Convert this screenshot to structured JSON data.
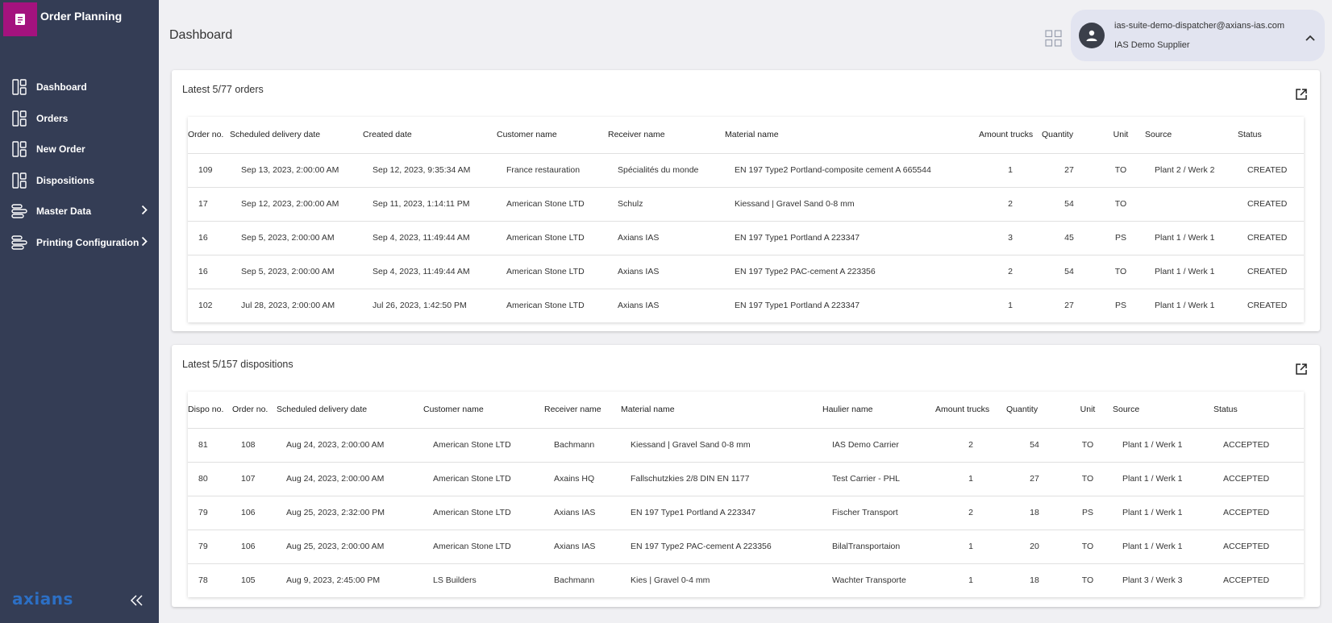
{
  "app": {
    "title": "Order Planning"
  },
  "sidebar": {
    "items": [
      {
        "label": "Dashboard",
        "icon": "dashboard-icon"
      },
      {
        "label": "Orders",
        "icon": "dashboard-icon"
      },
      {
        "label": "New Order",
        "icon": "dashboard-icon"
      },
      {
        "label": "Dispositions",
        "icon": "dashboard-icon"
      },
      {
        "label": "Master Data",
        "icon": "layers-icon"
      },
      {
        "label": "Printing Configuration",
        "icon": "layers-icon"
      }
    ],
    "logo_text": "axians"
  },
  "header": {
    "title": "Dashboard"
  },
  "user": {
    "email": "ias-suite-demo-dispatcher@axians-ias.com",
    "org": "IAS Demo Supplier"
  },
  "orders": {
    "title": "Latest 5/77 orders",
    "columns": [
      "Order no.",
      "Scheduled delivery date",
      "Created date",
      "Customer name",
      "Receiver name",
      "Material name",
      "Amount trucks",
      "Quantity",
      "Unit",
      "Source",
      "Status"
    ],
    "rows": [
      [
        "109",
        "Sep 13, 2023, 2:00:00 AM",
        "Sep 12, 2023, 9:35:34 AM",
        "France restauration",
        "Spécialités du monde",
        "EN 197 Type2 Portland-composite cement A 665544",
        "1",
        "27",
        "TO",
        "Plant 2 / Werk 2",
        "CREATED"
      ],
      [
        "17",
        "Sep 12, 2023, 2:00:00 AM",
        "Sep 11, 2023, 1:14:11 PM",
        "American Stone LTD",
        "Schulz",
        "Kiessand | Gravel Sand 0-8 mm",
        "2",
        "54",
        "TO",
        "",
        "CREATED"
      ],
      [
        "16",
        "Sep 5, 2023, 2:00:00 AM",
        "Sep 4, 2023, 11:49:44 AM",
        "American Stone LTD",
        "Axians IAS",
        "EN 197 Type1 Portland A 223347",
        "3",
        "45",
        "PS",
        "Plant 1 / Werk 1",
        "CREATED"
      ],
      [
        "16",
        "Sep 5, 2023, 2:00:00 AM",
        "Sep 4, 2023, 11:49:44 AM",
        "American Stone LTD",
        "Axians IAS",
        "EN 197 Type2 PAC-cement A 223356",
        "2",
        "54",
        "TO",
        "Plant 1 / Werk 1",
        "CREATED"
      ],
      [
        "102",
        "Jul 28, 2023, 2:00:00 AM",
        "Jul 26, 2023, 1:42:50 PM",
        "American Stone LTD",
        "Axians IAS",
        "EN 197 Type1 Portland A 223347",
        "1",
        "27",
        "PS",
        "Plant 1 / Werk 1",
        "CREATED"
      ]
    ]
  },
  "dispositions": {
    "title": "Latest 5/157 dispositions",
    "columns": [
      "Dispo no.",
      "Order no.",
      "Scheduled delivery date",
      "Customer name",
      "Receiver name",
      "Material name",
      "Haulier name",
      "Amount trucks",
      "Quantity",
      "Unit",
      "Source",
      "Status"
    ],
    "rows": [
      [
        "81",
        "108",
        "Aug 24, 2023, 2:00:00 AM",
        "American Stone LTD",
        "Bachmann",
        "Kiessand | Gravel Sand 0-8 mm",
        "IAS Demo Carrier",
        "2",
        "54",
        "TO",
        "Plant 1 / Werk 1",
        "ACCEPTED"
      ],
      [
        "80",
        "107",
        "Aug 24, 2023, 2:00:00 AM",
        "American Stone LTD",
        "Axains HQ",
        "Fallschutzkies 2/8 DIN EN 1177",
        "Test Carrier - PHL",
        "1",
        "27",
        "TO",
        "Plant 1 / Werk 1",
        "ACCEPTED"
      ],
      [
        "79",
        "106",
        "Aug 25, 2023, 2:32:00 PM",
        "American Stone LTD",
        "Axians IAS",
        "EN 197 Type1 Portland A 223347",
        "Fischer Transport",
        "2",
        "18",
        "PS",
        "Plant 1 / Werk 1",
        "ACCEPTED"
      ],
      [
        "79",
        "106",
        "Aug 25, 2023, 2:00:00 AM",
        "American Stone LTD",
        "Axians IAS",
        "EN 197 Type2 PAC-cement A 223356",
        "BilalTransportaion",
        "1",
        "20",
        "TO",
        "Plant 1 / Werk 1",
        "ACCEPTED"
      ],
      [
        "78",
        "105",
        "Aug 9, 2023, 2:45:00 PM",
        "LS Builders",
        "Bachmann",
        "Kies | Gravel 0-4 mm",
        "Wachter Transporte",
        "1",
        "18",
        "TO",
        "Plant 3 / Werk 3",
        "ACCEPTED"
      ]
    ]
  },
  "colors": {
    "sidebar": "#343d55",
    "brand": "#a4127e",
    "logo": "#2c6fc4",
    "user_card": "#e2e4f0"
  }
}
